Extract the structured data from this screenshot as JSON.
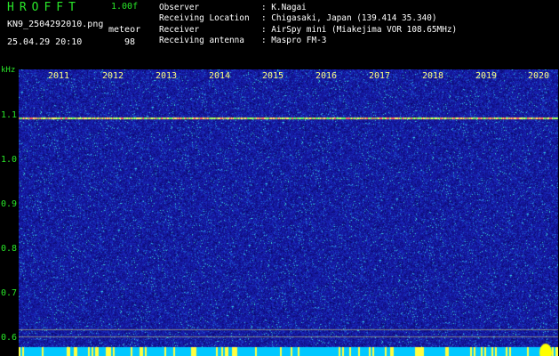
{
  "header": {
    "app_title": "HROFFT",
    "version": "1.00f",
    "filename": "KN9_2504292010.png",
    "datetime": "25.04.29 20:10",
    "meteor_label": "meteor",
    "meteor_count": "98"
  },
  "info": [
    {
      "key": "Observer",
      "value": ": K.Nagai"
    },
    {
      "key": "Receiving Location",
      "value": ": Chigasaki, Japan (139.414 35.340)"
    },
    {
      "key": "Receiver",
      "value": ": AirSpy mini (Miakejima VOR 108.65MHz)"
    },
    {
      "key": "Receiving antenna",
      "value": ": Maspro FM-3"
    }
  ],
  "axis": {
    "unit": "kHz",
    "y_ticks": [
      "1.1",
      "1.0",
      "0.9",
      "0.8",
      "0.7",
      "0.6"
    ],
    "x_ticks": [
      "2011",
      "2012",
      "2013",
      "2014",
      "2015",
      "2016",
      "2017",
      "2018",
      "2019",
      "2020"
    ]
  },
  "colors": {
    "background": "#000000",
    "spectrogram_base": "#1a1aa0",
    "header_green": "#29e629",
    "year_label": "#ffff80",
    "bottom_strip": "#00c8ff"
  }
}
